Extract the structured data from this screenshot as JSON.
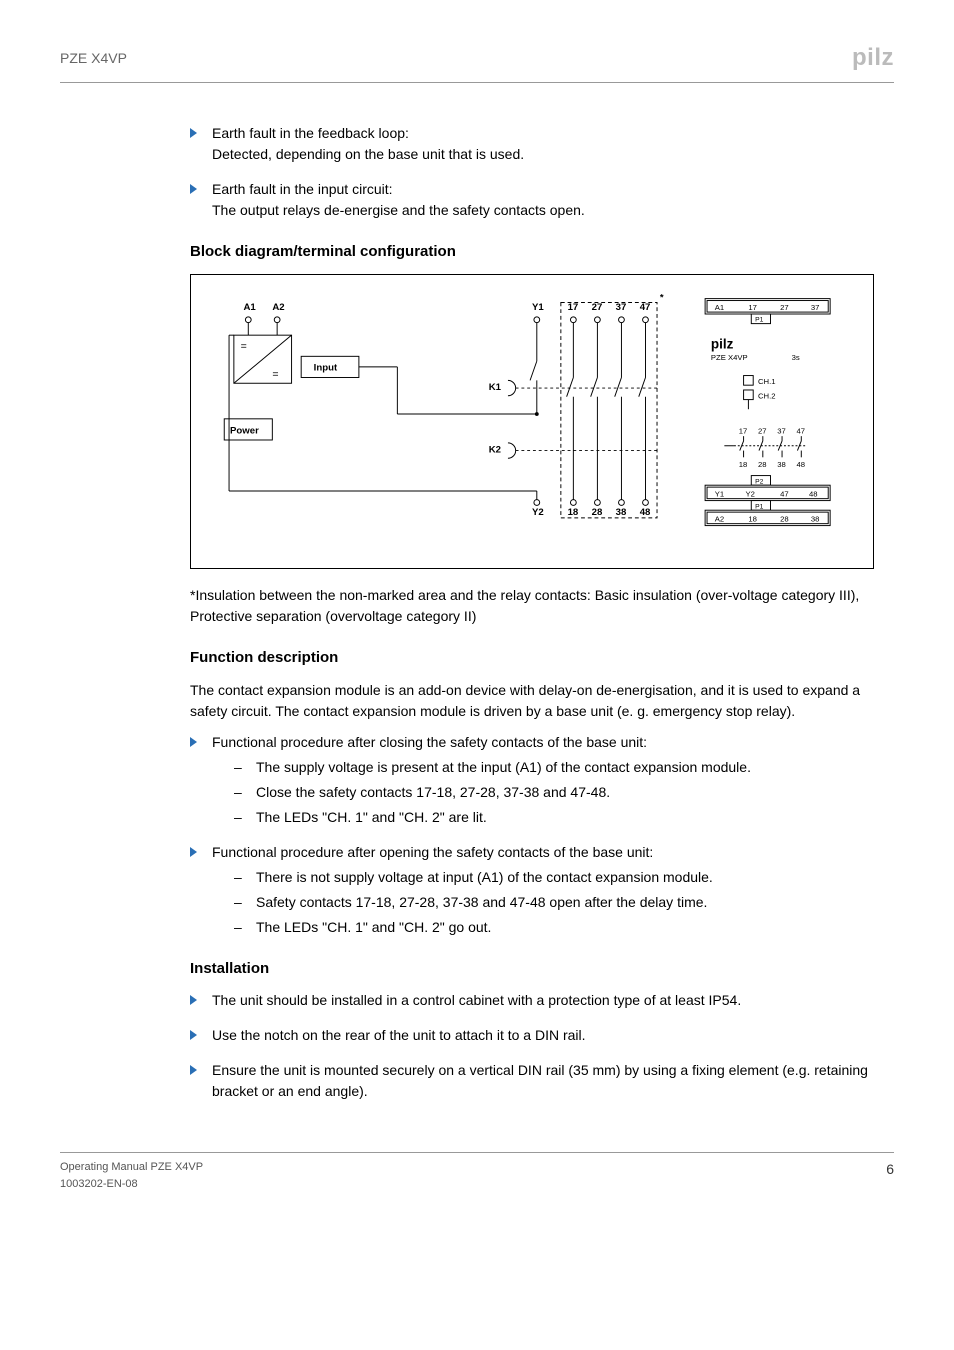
{
  "header": {
    "product": "PZE X4VP",
    "logo": "pilz"
  },
  "intro_bullets": [
    {
      "title": "Earth fault in the feedback loop:",
      "body": "Detected, depending on the base unit that is used."
    },
    {
      "title": "Earth fault in the input circuit:",
      "body": "The output relays de-energise and the safety contacts open."
    }
  ],
  "section1": {
    "heading": "Block diagram/terminal configuration",
    "labels": {
      "A1": "A1",
      "A2": "A2",
      "Y1": "Y1",
      "Y2": "Y2",
      "c17": "17",
      "c27": "27",
      "c37": "37",
      "c47": "47",
      "c18": "18",
      "c28": "28",
      "c38": "38",
      "c48": "48",
      "input": "Input",
      "power": "Power",
      "K1": "K1",
      "K2": "K2",
      "star": "*"
    },
    "front": {
      "row_top": [
        "A1",
        "17",
        "27",
        "37"
      ],
      "p1": "P1",
      "p2": "P2",
      "logo": "pilz",
      "model": "PZE X4VP",
      "time": "3s",
      "ch1": "CH.1",
      "ch2": "CH.2",
      "mid_top": [
        "17",
        "27",
        "37",
        "47"
      ],
      "mid_bot": [
        "18",
        "28",
        "38",
        "48"
      ],
      "row_b1": [
        "Y1",
        "Y2",
        "47",
        "48"
      ],
      "row_b2": [
        "A2",
        "18",
        "28",
        "38"
      ]
    },
    "note": "*Insulation between the non-marked area and the relay contacts: Basic insulation (over-voltage category III), Protective separation (overvoltage category II)"
  },
  "section2": {
    "heading": "Function description",
    "para": "The contact expansion module is an add-on device with delay-on de-energisation, and it is used to expand a safety circuit. The contact expansion module is driven by a base unit (e. g. emergency stop relay).",
    "bullets": [
      {
        "text": "Functional procedure after closing the safety contacts of the base unit:",
        "sub": [
          "The supply voltage is present at the input (A1) of the contact expansion module.",
          "Close the safety contacts 17-18, 27-28, 37-38 and 47-48.",
          "The LEDs \"CH. 1\" and \"CH. 2\" are lit."
        ]
      },
      {
        "text": "Functional procedure after opening the safety contacts of the base unit:",
        "sub": [
          "There is not supply voltage at input (A1) of the contact expansion module.",
          "Safety contacts 17-18, 27-28, 37-38 and 47-48 open after the delay time.",
          "The LEDs \"CH. 1\" and \"CH. 2\" go out."
        ]
      }
    ]
  },
  "section3": {
    "heading": "Installation",
    "bullets": [
      "The unit should be installed in a control cabinet with a protection type of at least IP54.",
      "Use the notch on the rear of the unit to attach it to a DIN rail.",
      "Ensure the unit is mounted securely on a vertical DIN rail (35 mm) by using a fixing element (e.g. retaining bracket or an end angle)."
    ]
  },
  "footer": {
    "line1": "Operating Manual PZE X4VP",
    "line2": "1003202-EN-08",
    "page": "6"
  }
}
